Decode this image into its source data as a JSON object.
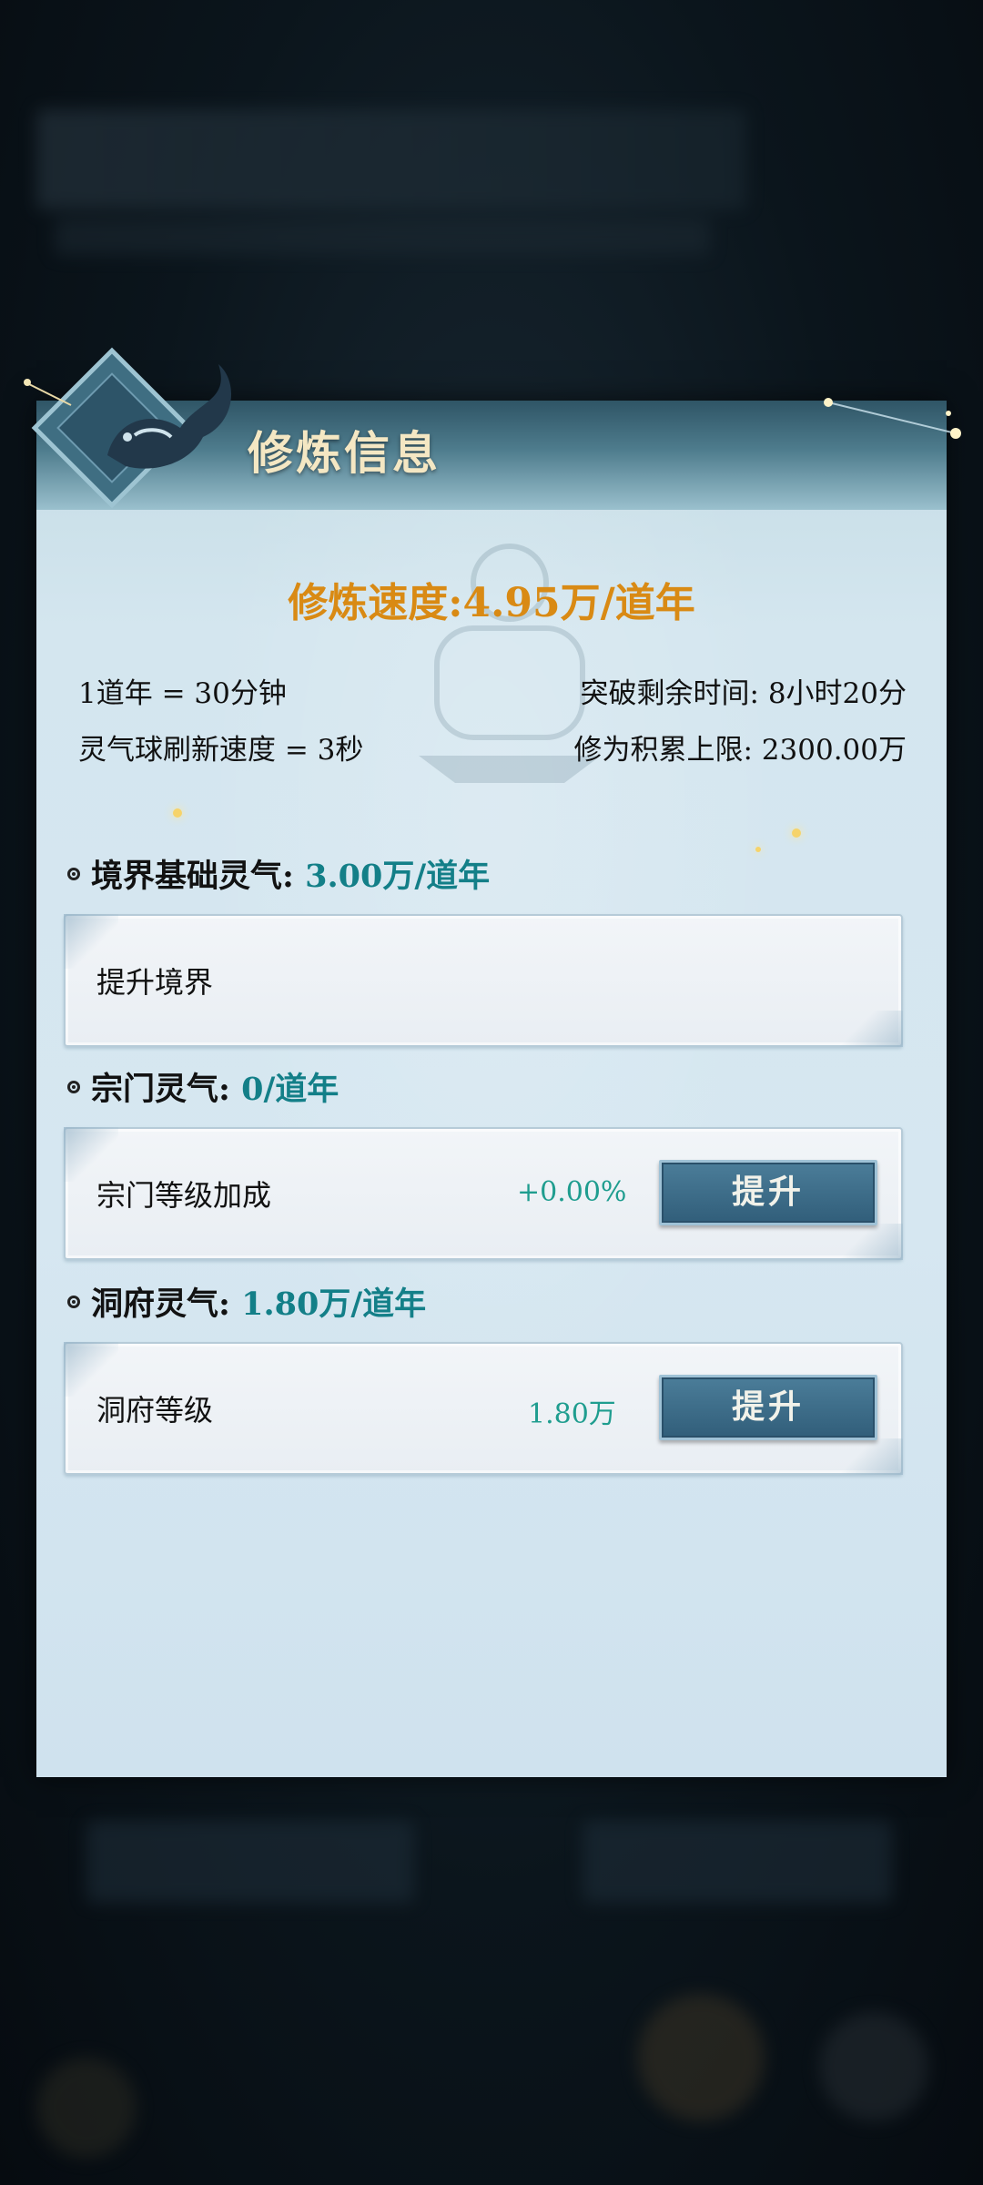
{
  "panel": {
    "title": "修炼信息",
    "cultivation_speed": "修炼速度:4.95万/道年",
    "info": {
      "year_conversion": "1道年 = 30分钟",
      "refresh_speed": "灵气球刷新速度 = 3秒",
      "breakthrough_time": "突破剩余时间: 8小时20分",
      "accumulation_limit": "修为积累上限: 2300.00万"
    }
  },
  "sections": {
    "realm": {
      "label": "境界基础灵气:",
      "value": "3.00万/道年",
      "card_label": "提升境界"
    },
    "sect": {
      "label": "宗门灵气:",
      "value": "0/道年",
      "card_label": "宗门等级加成",
      "card_value": "+0.00%",
      "button": "提升"
    },
    "cave": {
      "label": "洞府灵气:",
      "value": "1.80万/道年",
      "card_label": "洞府等级",
      "card_value": "1.80万",
      "button": "提升"
    }
  },
  "colors": {
    "speed": "#d98a14",
    "value_teal": "#137f88",
    "title": "#f4e7c3",
    "button": "#3b6b87"
  }
}
